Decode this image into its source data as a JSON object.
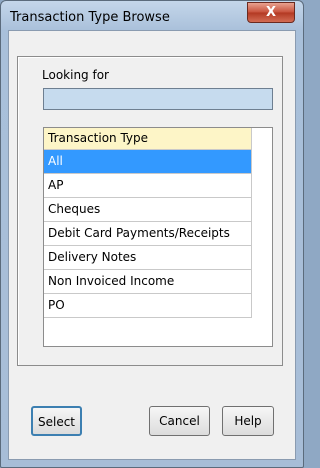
{
  "window": {
    "title": "Transaction Type Browse",
    "close_label": "X"
  },
  "search": {
    "label": "Looking for",
    "value": ""
  },
  "list": {
    "header": "Transaction Type",
    "items": [
      "All",
      "AP",
      "Cheques",
      "Debit Card Payments/Receipts",
      "Delivery Notes",
      "Non Invoiced Income",
      "PO"
    ],
    "selected": "All"
  },
  "buttons": {
    "select": "Select",
    "cancel": "Cancel",
    "help": "Help"
  }
}
